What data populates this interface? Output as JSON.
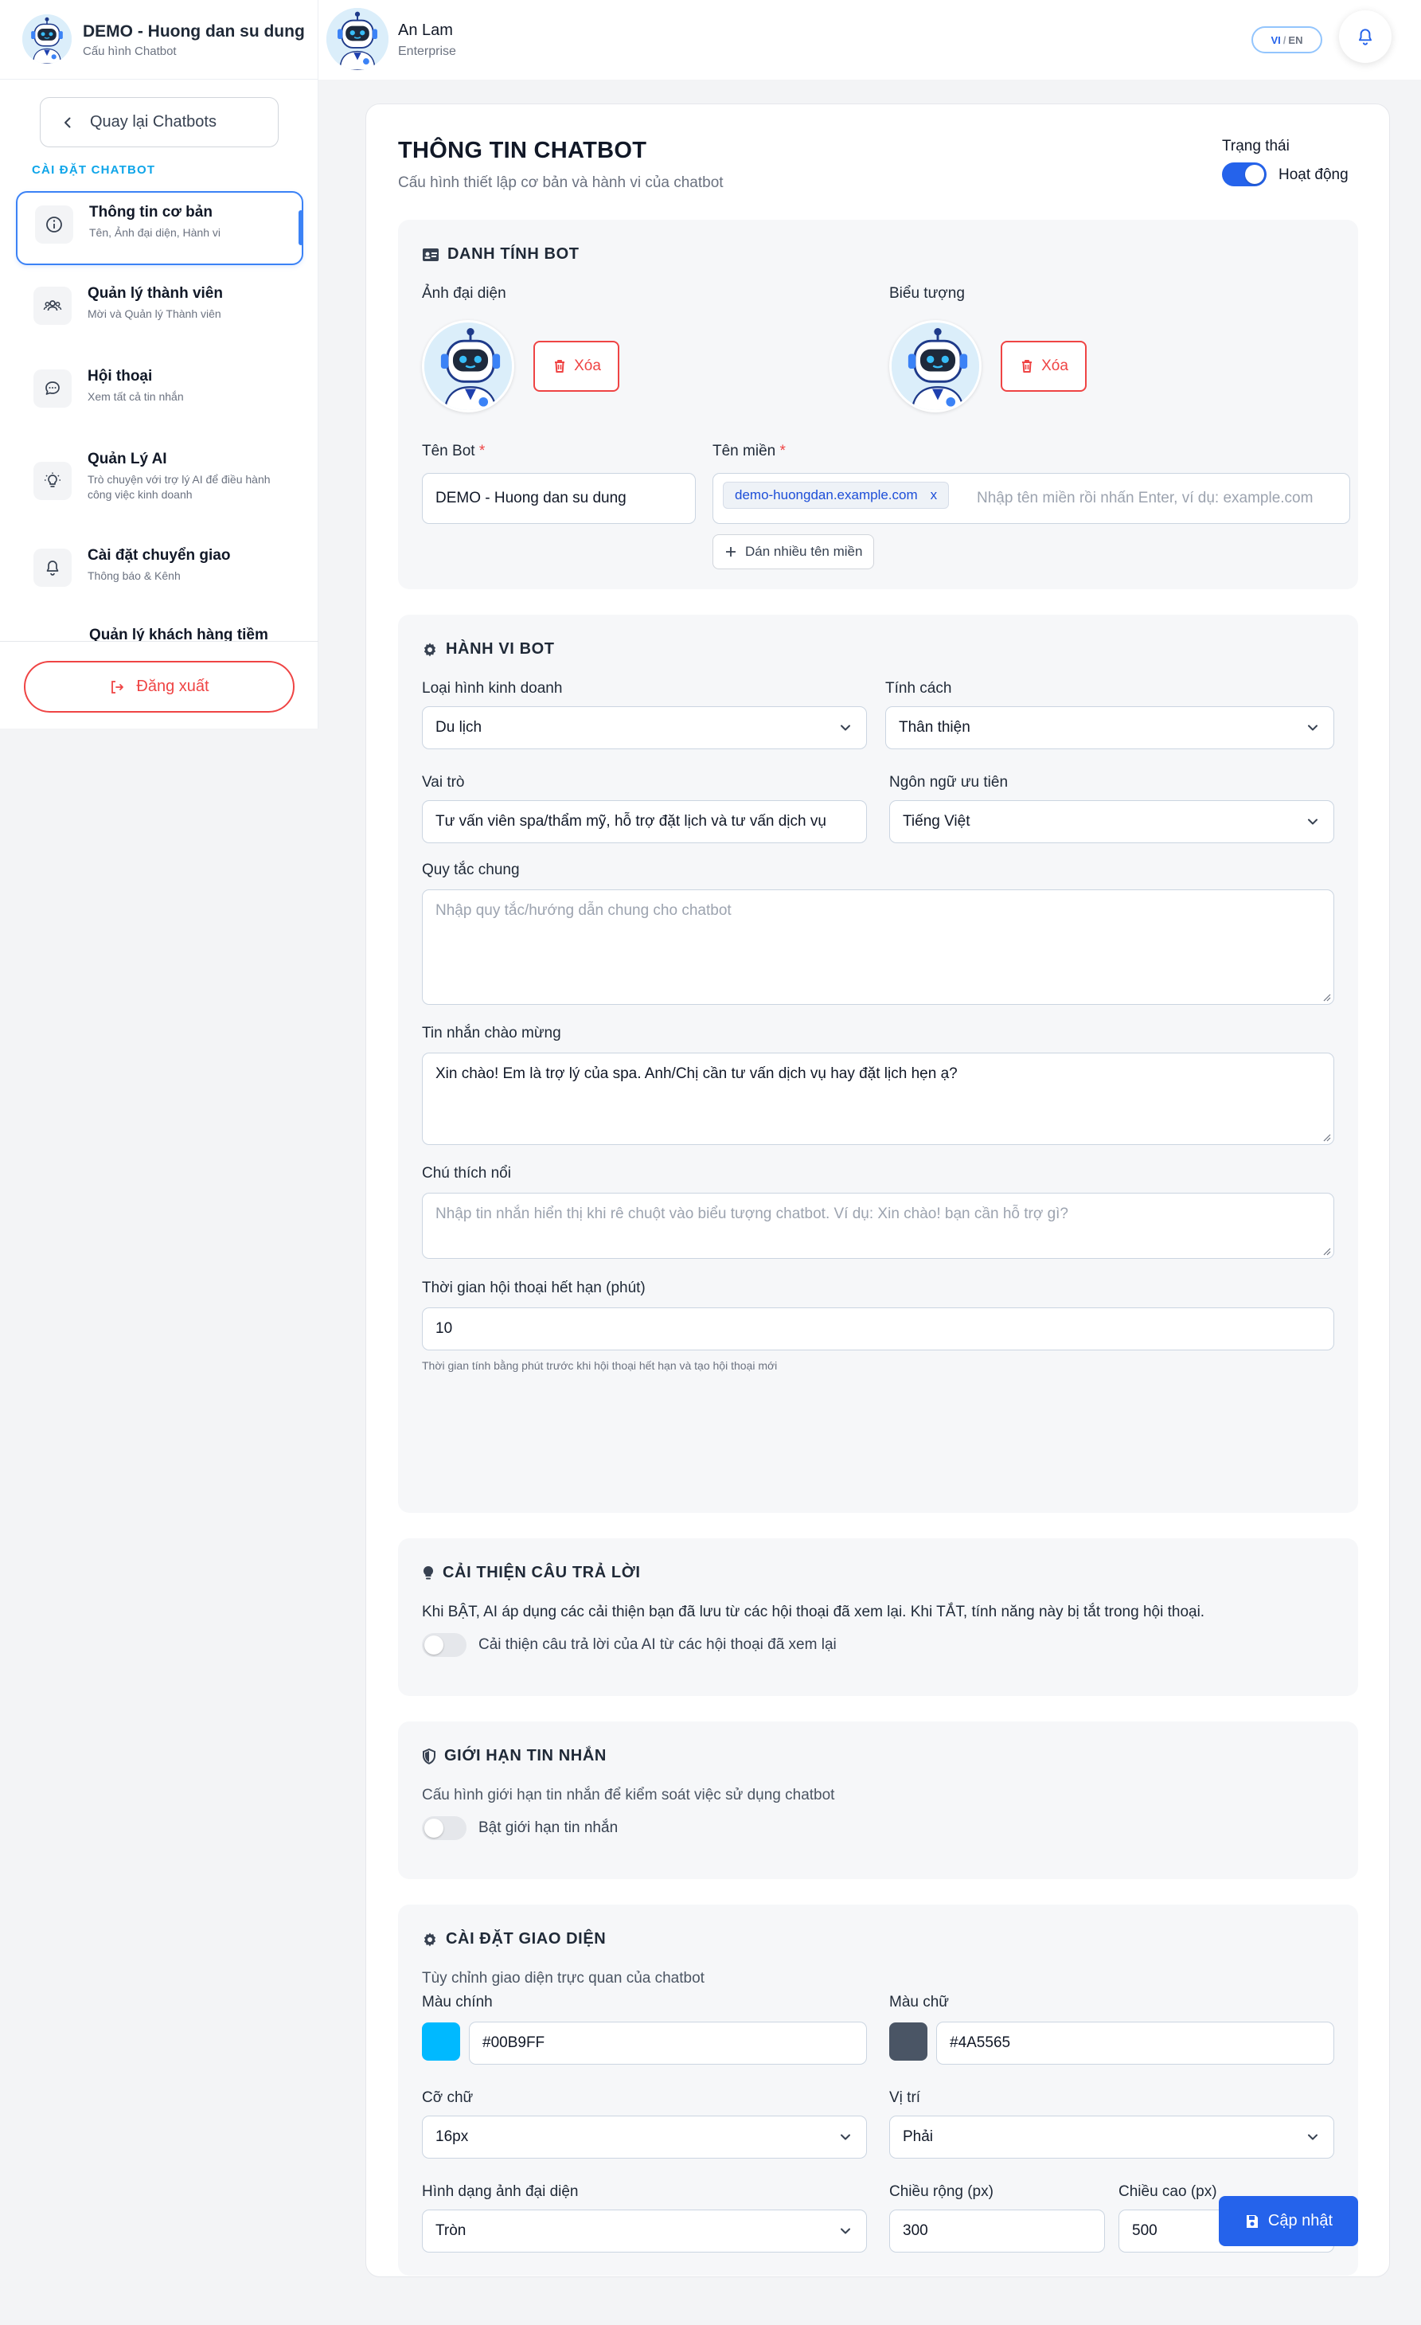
{
  "sidebar": {
    "bot_name": "DEMO - Huong dan su dung",
    "bot_sub": "Cấu hình Chatbot",
    "back_label": "Quay lại Chatbots",
    "section_title": "CÀI ĐẶT CHATBOT",
    "items": [
      {
        "title": "Thông tin cơ bản",
        "sub": "Tên, Ảnh đại diện, Hành vi",
        "icon": "info-icon"
      },
      {
        "title": "Quản lý thành viên",
        "sub": "Mời và Quản lý Thành viên",
        "icon": "users-icon"
      },
      {
        "title": "Hội thoại",
        "sub": "Xem tất cả tin nhắn",
        "icon": "chat-icon"
      },
      {
        "title": "Quản Lý AI",
        "sub": "Trò chuyện với trợ lý AI để điều hành công việc kinh doanh",
        "icon": "bulb-icon"
      },
      {
        "title": "Cài đặt chuyển giao",
        "sub": "Thông báo & Kênh",
        "icon": "bell-icon"
      },
      {
        "title": "Quản lý khách hàng tiềm",
        "sub": "",
        "icon": ""
      }
    ],
    "logout_label": "Đăng xuất"
  },
  "topbar": {
    "user_name": "An Lam",
    "user_plan": "Enterprise",
    "lang_active": "VI",
    "lang_sep": "/",
    "lang_other": "EN"
  },
  "page": {
    "title": "THÔNG TIN CHATBOT",
    "subtitle": "Cấu hình thiết lập cơ bản và hành vi của chatbot",
    "status_label": "Trạng thái",
    "status_value": "Hoạt động"
  },
  "identity": {
    "title": "DANH TÍNH BOT",
    "avatar_label": "Ảnh đại diện",
    "icon_label": "Biểu tượng",
    "delete_label": "Xóa",
    "name_label": "Tên Bot",
    "name_value": "DEMO - Huong dan su dung",
    "domain_label": "Tên miền",
    "domain_chip": "demo-huongdan.example.com",
    "domain_chip_remove": "x",
    "domain_placeholder": "Nhập tên miền rồi nhấn Enter, ví dụ: example.com",
    "add_domains_label": "Dán nhiều tên miền",
    "required_mark": "*"
  },
  "behavior": {
    "title": "HÀNH VI BOT",
    "business_label": "Loại hình kinh doanh",
    "business_value": "Du lịch",
    "personality_label": "Tính cách",
    "personality_value": "Thân thiện",
    "role_label": "Vai trò",
    "role_value": "Tư vấn viên spa/thẩm mỹ, hỗ trợ đặt lịch và tư vấn dịch vụ",
    "language_label": "Ngôn ngữ ưu tiên",
    "language_value": "Tiếng Việt",
    "rules_label": "Quy tắc chung",
    "rules_placeholder": "Nhập quy tắc/hướng dẫn chung cho chatbot",
    "welcome_label": "Tin nhắn chào mừng",
    "welcome_value": "Xin chào! Em là trợ lý của spa. Anh/Chị cần tư vấn dịch vụ hay đặt lịch hẹn ạ?",
    "tooltip_label": "Chú thích nổi",
    "tooltip_placeholder": "Nhập tin nhắn hiển thị khi rê chuột vào biểu tượng chatbot. Ví dụ: Xin chào! bạn cần hỗ trợ gì?",
    "timeout_label": "Thời gian hội thoại hết hạn (phút)",
    "timeout_value": "10",
    "timeout_hint": "Thời gian tính bằng phút trước khi hội thoại hết hạn và tạo hội thoại mới"
  },
  "improve": {
    "title": "CẢI THIỆN CÂU TRẢ LỜI",
    "desc": "Khi BẬT, AI áp dụng các cải thiện bạn đã lưu từ các hội thoại đã xem lại. Khi TẮT, tính năng này bị tắt trong hội thoại.",
    "toggle_label": "Cải thiện câu trả lời của AI từ các hội thoại đã xem lại",
    "enabled": false
  },
  "limit": {
    "title": "GIỚI HẠN TIN NHẮN",
    "desc": "Cấu hình giới hạn tin nhắn để kiểm soát việc sử dụng chatbot",
    "toggle_label": "Bật giới hạn tin nhắn",
    "enabled": false
  },
  "appearance": {
    "title": "CÀI ĐẶT GIAO DIỆN",
    "desc": "Tùy chỉnh giao diện trực quan của chatbot",
    "primary_label": "Màu chính",
    "primary_value": "#00B9FF",
    "text_color_label": "Màu chữ",
    "text_color_value": "#4A5565",
    "font_size_label": "Cỡ chữ",
    "font_size_value": "16px",
    "position_label": "Vị trí",
    "position_value": "Phải",
    "shape_label": "Hình dạng ảnh đại diện",
    "shape_value": "Tròn",
    "width_label": "Chiều rộng (px)",
    "width_value": "300",
    "height_label": "Chiều cao (px)",
    "height_value": "500"
  },
  "actions": {
    "update_label": "Cập nhật"
  },
  "colors": {
    "accent": "#2563eb",
    "danger": "#ef4444",
    "section_title": "#0ea5e9"
  }
}
